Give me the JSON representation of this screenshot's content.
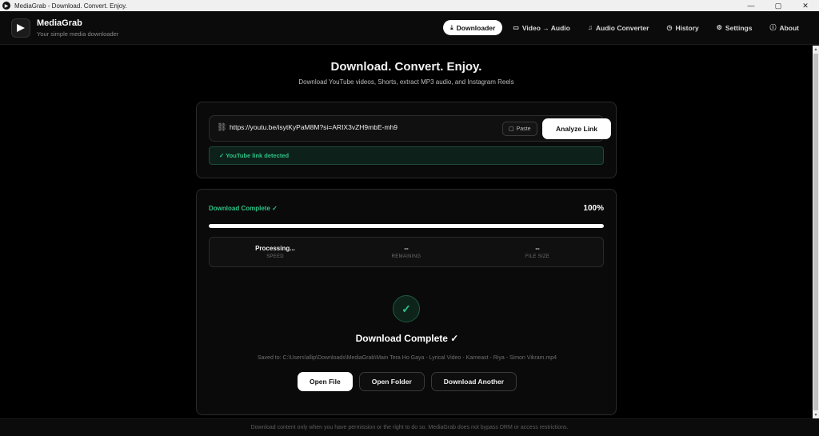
{
  "window": {
    "title": "MediaGrab - Download. Convert. Enjoy.",
    "controls": {
      "minimize": "—",
      "maximize": "▢",
      "close": "✕"
    }
  },
  "brand": {
    "name": "MediaGrab",
    "tagline": "Your simple media downloader"
  },
  "nav": [
    {
      "label": "Downloader",
      "icon": "download-icon",
      "glyph": "⤓",
      "active": true
    },
    {
      "label": "Video → Audio",
      "icon": "video-camera-icon",
      "glyph": "▭",
      "active": false
    },
    {
      "label": "Audio Converter",
      "icon": "music-note-icon",
      "glyph": "♫",
      "active": false
    },
    {
      "label": "History",
      "icon": "clock-icon",
      "glyph": "◷",
      "active": false
    },
    {
      "label": "Settings",
      "icon": "gear-icon",
      "glyph": "⚙",
      "active": false
    },
    {
      "label": "About",
      "icon": "info-icon",
      "glyph": "ⓘ",
      "active": false
    }
  ],
  "hero": {
    "title": "Download. Convert. Enjoy.",
    "subtitle": "Download YouTube videos, Shorts, extract MP3 audio, and Instagram Reels"
  },
  "input": {
    "url_value": "https://youtu.be/isytKyPaM8M?si=ARIX3vZH9mbE-mh9",
    "paste_label": "Paste",
    "analyze_label": "Analyze Link",
    "detected_text": "✓ YouTube link detected"
  },
  "progress": {
    "status": "Download Complete ✓",
    "percent_label": "100%",
    "percent_value": 100,
    "stats": [
      {
        "value": "Processing...",
        "label": "SPEED"
      },
      {
        "value": "--",
        "label": "REMAINING"
      },
      {
        "value": "--",
        "label": "FILE SIZE"
      }
    ]
  },
  "result": {
    "check_glyph": "✓",
    "title": "Download Complete ✓",
    "saved_path": "Saved to: C:\\Users\\allip\\Downloads\\MediaGrab\\Main Tera Ho Gaya - Lyrical Video - Karneast - Riya - Simon Vikram.mp4",
    "actions": {
      "open_file": "Open File",
      "open_folder": "Open Folder",
      "download_another": "Download Another"
    }
  },
  "footer": {
    "text": "Download content only when you have permission or the right to do so. MediaGrab does not bypass DRM or access restrictions."
  },
  "colors": {
    "accent_green": "#2ec387",
    "background": "#000000",
    "card_border": "#2a2a2a"
  }
}
